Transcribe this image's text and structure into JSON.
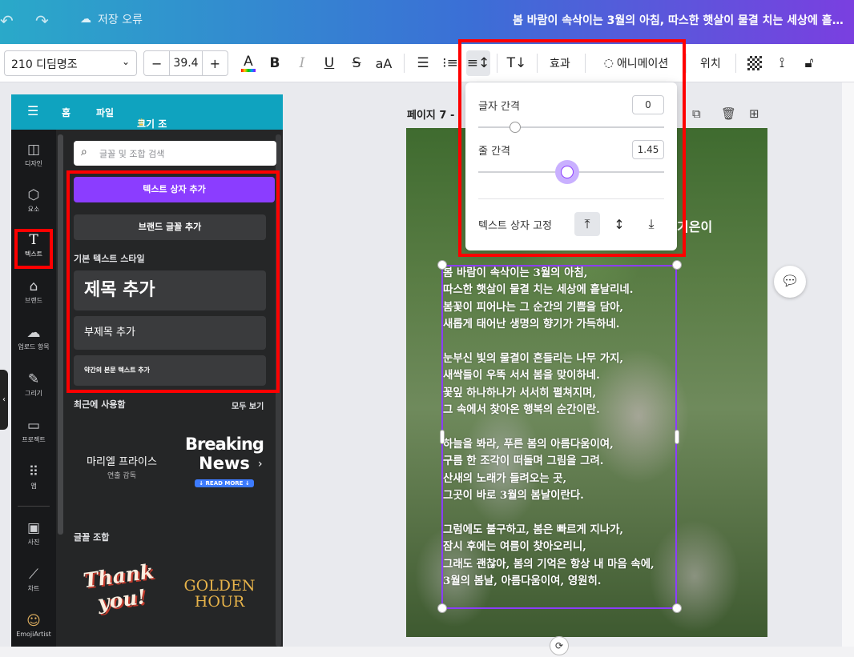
{
  "topbar": {
    "save_status": "저장 오류",
    "doc_title": "봄 바람이 속삭이는 3월의 아침, 따스한 햇살이 물결 치는 세상에 흩날리네."
  },
  "toolbar": {
    "font_name": "210 디딤명조",
    "font_size": "39.4",
    "minus": "−",
    "plus": "+",
    "effects_label": "효과",
    "animation_label": "애니메이션",
    "position_label": "위치"
  },
  "panel_header": {
    "menu_icon": "menu-icon",
    "home": "홈",
    "file": "파일",
    "resize": "크기 조정 및 Magic Switch"
  },
  "rail": [
    {
      "icon": "design-icon",
      "glyph": "◫",
      "label": "디자인"
    },
    {
      "icon": "elements-icon",
      "glyph": "⬡",
      "label": "요소"
    },
    {
      "icon": "text-icon",
      "glyph": "T",
      "label": "텍스트"
    },
    {
      "icon": "brand-icon",
      "glyph": "⌂",
      "label": "브랜드"
    },
    {
      "icon": "upload-icon",
      "glyph": "☁",
      "label": "업로드 항목"
    },
    {
      "icon": "draw-icon",
      "glyph": "✎",
      "label": "그리기"
    },
    {
      "icon": "projects-icon",
      "glyph": "▭",
      "label": "프로젝트"
    },
    {
      "icon": "apps-icon",
      "glyph": "⠿",
      "label": "앱"
    },
    {
      "icon": "photos-icon",
      "glyph": "▣",
      "label": "사진"
    },
    {
      "icon": "charts-icon",
      "glyph": "⟋",
      "label": "차트"
    },
    {
      "icon": "emoji-artist-icon",
      "glyph": "☺",
      "label": "EmojiArtist"
    }
  ],
  "text_panel": {
    "search_placeholder": "글꼴 및 조합 검색",
    "add_textbox": "텍스트 상자 추가",
    "add_brand_font": "브랜드 글꼴 추가",
    "default_styles_label": "기본 텍스트 스타일",
    "heading": "제목 추가",
    "subheading": "부제목 추가",
    "body": "약간의 본문 텍스트 추가",
    "recent_label": "최근에 사용함",
    "see_all": "모두 보기",
    "recent_1_title": "마리엘 프라이스",
    "recent_1_sub": "연출 감독",
    "recent_2_line1": "Breaking",
    "recent_2_line2": "News",
    "recent_2_badge": "↓ READ MORE ↓",
    "combos_label": "글꼴 조합",
    "combo_1": "Thank you!",
    "combo_2_line1": "GOLDEN",
    "combo_2_line2": "HOUR"
  },
  "canvas": {
    "page_label": "페이지 7 -",
    "heading_fragment": "기은이",
    "poem": [
      [
        "봄 바람이 속삭이는 3월의 아침,",
        "따스한 햇살이 물결 치는 세상에 흩날리네.",
        "봄꽃이 피어나는 그 순간의 기쁨을 담아,",
        "새롭게 태어난 생명의 향기가 가득하네."
      ],
      [
        "눈부신 빛의 물결이 흔들리는 나무 가지,",
        "새싹들이 우뚝 서서 봄을 맞이하네.",
        "꽃잎 하나하나가 서서히 펼쳐지며,",
        "그 속에서 찾아온 행복의 순간이란."
      ],
      [
        "하늘을 봐라, 푸른 봄의 아름다움이여,",
        "구름 한 조각이 떠돌며 그림을 그려.",
        "산새의 노래가 들려오는 곳,",
        "그곳이 바로 3월의 봄날이란다."
      ],
      [
        "그럼에도 불구하고, 봄은 빠르게 지나가,",
        "잠시 후에는 여름이 찾아오리니,",
        "그래도 괜찮아, 봄의 기억은 항상 내 마음 속에,",
        "3월의 봄날, 아름다움이여, 영원히."
      ]
    ]
  },
  "spacing_popover": {
    "letter_spacing_label": "글자 간격",
    "letter_spacing_value": "0",
    "letter_spacing_fraction": 0.2,
    "line_spacing_label": "줄 간격",
    "line_spacing_value": "1.45",
    "line_spacing_fraction": 0.48,
    "anchor_label": "텍스트 상자 고정"
  },
  "colors": {
    "accent": "#8b3dff",
    "highlight": "#ff0000",
    "panel_header": "#0fa3bf"
  }
}
